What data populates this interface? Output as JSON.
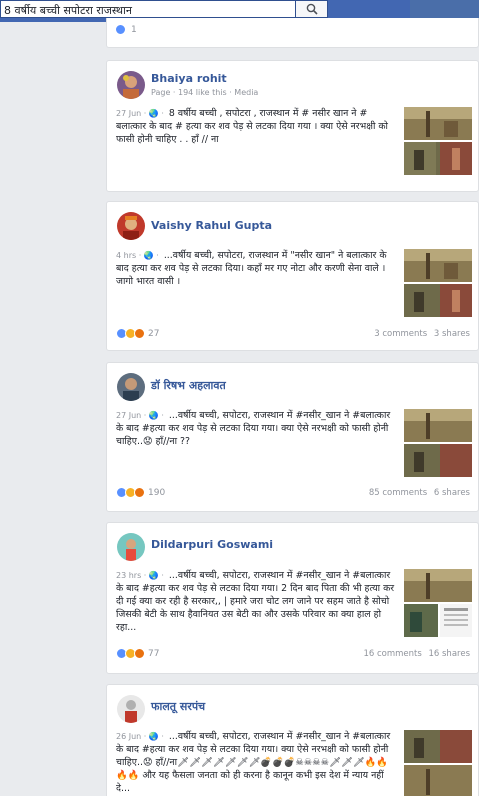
{
  "search": {
    "value": "8 वर्षीय बच्ची सपोटरा राजस्थान"
  },
  "prev_post": {
    "reaction_count": "1"
  },
  "posts": [
    {
      "author": "Bhaiya rohit",
      "subtitle": "Page · 194 like this · Media",
      "meta": "27 Jun · 🌏 ·",
      "text": "8 वर्षीय बच्ची , सपोटरा , राजस्थान में # नसीर खान ने # बलात्कार के बाद # हत्या कर शव पेड़ से लटका दिया गया । क्या ऐसे नरभक्षी को फासी होनी चाहिए . . हाँ // ना"
    },
    {
      "author": "Vaishy Rahul Gupta",
      "meta": "4 hrs · 🌏 ·",
      "text": "...वर्षीय बच्ची, सपोटरा, राजस्थान में \"नसीर खान\" ने बलात्कार के बाद हत्या कर शव पेड़ से लटका दिया। कहाँ मर गए नोटा और करणी सेना वाले । जागो भारत वासी ।",
      "reaction_count": "27",
      "comments": "3 comments",
      "shares": "3 shares"
    },
    {
      "author": "डॉ रिषभ अहलावत",
      "meta": "27 Jun · 🌏 ·",
      "text": "...वर्षीय बच्ची, सपोटरा, राजस्थान में #नसीर_खान ने #बलात्कार के बाद #हत्या कर शव पेड़ से लटका दिया गया। क्या ऐसे नरभक्षी को फासी होनी चाहिए..😟 हाँ//ना ??",
      "reaction_count": "190",
      "comments": "85 comments",
      "shares": "6 shares"
    },
    {
      "author": "Dildarpuri Goswami",
      "meta": "23 hrs · 🌏 ·",
      "text": "...वर्षीय बच्ची, सपोटरा, राजस्थान में #नसीर_खान ने #बलात्कार के बाद #हत्या कर शव पेड़ से लटका दिया गया। 2 दिन बाद पिता की भी हत्या कर दी गई क्या कर रही है सरकार,, | हमारे जरा चोट लग जाने पर सहम जाते है सोचो जिसकी बेटी के साथ हैवानियत उस बेटी का और उसके परिवार का क्या हाल हो रहा...",
      "reaction_count": "77",
      "comments": "16 comments",
      "shares": "16 shares"
    },
    {
      "author": "फालतू सरपंच",
      "meta": "26 Jun · 🌏 ·",
      "text": "...वर्षीय बच्ची, सपोटरा, राजस्थान में #नसीर_खान ने #बलात्कार के बाद #हत्या कर शव पेड़ से लटका दिया गया। क्या ऐसे नरभक्षी को फासी होनी चाहिए..😟 हाँ//ना🗡🗡🗡🗡🗡🗡🗡💣💣💣☠☠☠☠🗡🗡🗡🔥🔥🔥🔥 और यह फैसला जनता को ही करना है कानून कभी इस देश में न्याय नहीं दे..."
    }
  ],
  "colors": {
    "topbar": "#4267b2",
    "link": "#365899",
    "like": "#5890ff",
    "sad": "#f7b125",
    "angry": "#e9710f"
  },
  "icons": [
    "search-icon",
    "globe-icon",
    "like-reaction-icon",
    "sad-reaction-icon",
    "angry-reaction-icon"
  ]
}
